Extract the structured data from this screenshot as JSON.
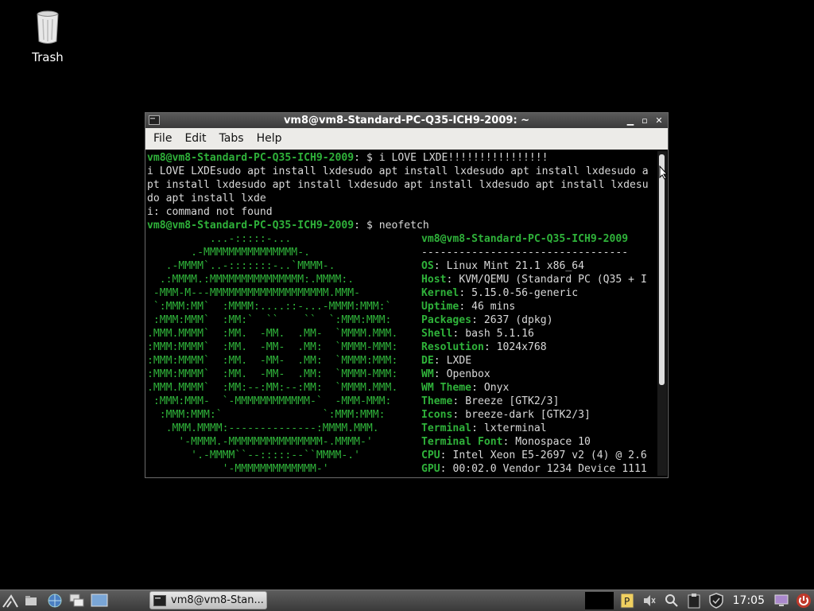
{
  "desktop": {
    "trash_label": "Trash"
  },
  "window": {
    "title": "vm8@vm8-Standard-PC-Q35-ICH9-2009: ~",
    "menu": [
      "File",
      "Edit",
      "Tabs",
      "Help"
    ]
  },
  "terminal": {
    "prompt": "vm8@vm8-Standard-PC-Q35-ICH9-2009",
    "cmd1": "$ i LOVE LXDE!!!!!!!!!!!!!!!!",
    "out1": "i LOVE LXDEsudo apt install lxdesudo apt install lxdesudo apt install lxdesudo a",
    "out2": "pt install lxdesudo apt install lxdesudo apt install lxdesudo apt install lxdesu",
    "out3": "do apt install lxde",
    "out4": "i: command not found",
    "cmd2": "$ neofetch",
    "logo": [
      "          ...-:::::-...",
      "       .-MMMMMMMMMMMMMMM-.",
      "   .-MMMM`..-:::::::-..`MMMM-.",
      "  .:MMMM.:MMMMMMMMMMMMMMM:.MMMM:.",
      " -MMM-M---MMMMMMMMMMMMMMMMMMM.MMM-",
      " `:MMM:MM`  :MMMM:....::-...-MMMM:MMM:`",
      " :MMM:MMM`  :MM:`  ``    ``  `:MMM:MMM:",
      ".MMM.MMMM`  :MM.  -MM.  .MM-  `MMMM.MMM.",
      ":MMM:MMMM`  :MM.  -MM-  .MM:  `MMMM-MMM:",
      ":MMM:MMMM`  :MM.  -MM-  .MM:  `MMMM:MMM:",
      ":MMM:MMMM`  :MM.  -MM-  .MM:  `MMMM-MMM:",
      ".MMM.MMMM`  :MM:--:MM:--:MM:  `MMMM.MMM.",
      " :MMM:MMM-  `-MMMMMMMMMMMM-`  -MMM-MMM:",
      "  :MMM:MMM:`                `:MMM:MMM:",
      "   .MMM.MMMM:--------------:MMMM.MMM.",
      "     '-MMMM.-MMMMMMMMMMMMMMM-.MMMM-'",
      "       '.-MMMM``--:::::--``MMMM-.'",
      "            '-MMMMMMMMMMMMM-'"
    ],
    "nf_header": "vm8@vm8-Standard-PC-Q35-ICH9-2009",
    "nf_sep": "---------------------------------",
    "info": [
      {
        "k": "OS",
        "v": "Linux Mint 21.1 x86_64"
      },
      {
        "k": "Host",
        "v": "KVM/QEMU (Standard PC (Q35 + I"
      },
      {
        "k": "Kernel",
        "v": "5.15.0-56-generic"
      },
      {
        "k": "Uptime",
        "v": "46 mins"
      },
      {
        "k": "Packages",
        "v": "2637 (dpkg)"
      },
      {
        "k": "Shell",
        "v": "bash 5.1.16"
      },
      {
        "k": "Resolution",
        "v": "1024x768"
      },
      {
        "k": "DE",
        "v": "LXDE"
      },
      {
        "k": "WM",
        "v": "Openbox"
      },
      {
        "k": "WM Theme",
        "v": "Onyx"
      },
      {
        "k": "Theme",
        "v": "Breeze [GTK2/3]"
      },
      {
        "k": "Icons",
        "v": "breeze-dark [GTK2/3]"
      },
      {
        "k": "Terminal",
        "v": "lxterminal"
      },
      {
        "k": "Terminal Font",
        "v": "Monospace 10"
      },
      {
        "k": "CPU",
        "v": "Intel Xeon E5-2697 v2 (4) @ 2.6"
      },
      {
        "k": "GPU",
        "v": "00:02.0 Vendor 1234 Device 1111"
      }
    ]
  },
  "taskbar": {
    "task_label": "vm8@vm8-Stan...",
    "clock": "17:05"
  },
  "colors": {
    "accent_green": "#2fb23a",
    "menubar_bg": "#ecebe8"
  }
}
